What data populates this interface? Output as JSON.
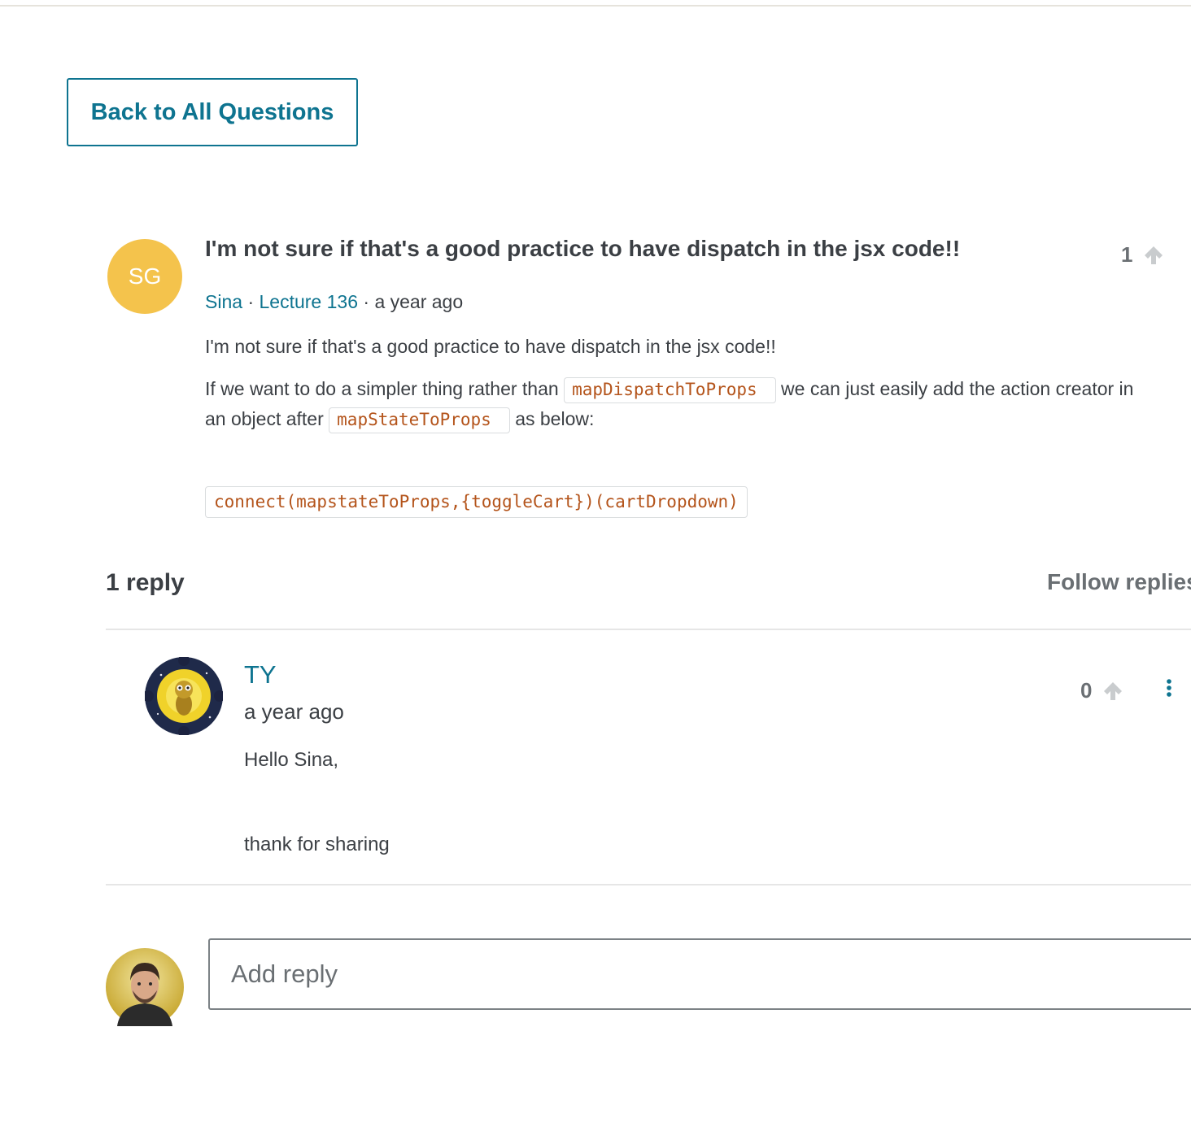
{
  "nav": {
    "back_label": "Back to All Questions"
  },
  "question": {
    "avatar_initials": "SG",
    "avatar_color": "#f4c34c",
    "title": "I'm not sure if that's a good practice to have dispatch in the jsx code!!",
    "votes": "1",
    "author": "Sina",
    "separator": "·",
    "lecture": "Lecture 136",
    "time": "a year ago",
    "body_p1": "I'm not sure if that's a good practice to have dispatch in the jsx code!!",
    "body_p2_a": "If we want to do a simpler thing rather than ",
    "body_p2_code1": "mapDispatchToProps",
    "body_p2_b": " we can just easily add the action creator in an object after ",
    "body_p2_code2": "mapStateToProps",
    "body_p2_c": " as below:",
    "code_block": "connect(mapstateToProps,{toggleCart})(cartDropdown)"
  },
  "replies_header": {
    "count_label": "1 reply",
    "follow_label": "Follow replies"
  },
  "replies": [
    {
      "name": "TY",
      "time": "a year ago",
      "votes": "0",
      "line1": "Hello Sina,",
      "line2": "thank for sharing"
    }
  ],
  "reply_box": {
    "placeholder": "Add reply"
  },
  "colors": {
    "accent": "#0e7490",
    "code": "#b4541b",
    "muted": "#6a6f73"
  },
  "icons": [
    "arrow-up-icon",
    "more-vertical-icon"
  ]
}
